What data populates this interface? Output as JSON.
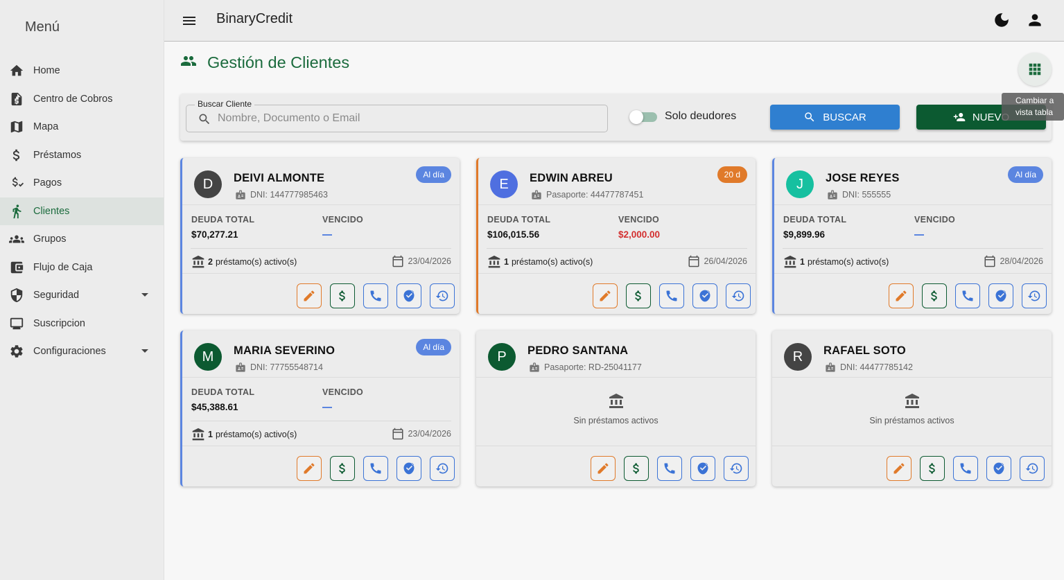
{
  "sidebar": {
    "title": "Menú",
    "items": [
      {
        "label": "Home",
        "icon": "home-icon"
      },
      {
        "label": "Centro de Cobros",
        "icon": "receipt-icon"
      },
      {
        "label": "Mapa",
        "icon": "map-icon"
      },
      {
        "label": "Préstamos",
        "icon": "dollar-icon"
      },
      {
        "label": "Pagos",
        "icon": "payment-icon"
      },
      {
        "label": "Clientes",
        "icon": "person-icon",
        "active": true
      },
      {
        "label": "Grupos",
        "icon": "groups-icon"
      },
      {
        "label": "Flujo de Caja",
        "icon": "wallet-icon"
      },
      {
        "label": "Seguridad",
        "icon": "shield-icon",
        "expandable": true
      },
      {
        "label": "Suscripcion",
        "icon": "monitor-icon"
      },
      {
        "label": "Configuraciones",
        "icon": "gear-icon",
        "expandable": true
      }
    ]
  },
  "topbar": {
    "title": "BinaryCredit"
  },
  "page": {
    "title": "Gestión de Clientes",
    "view_tooltip": "Cambiar a vista tabla"
  },
  "search": {
    "legend": "Buscar Cliente",
    "placeholder": "Nombre, Documento o Email",
    "value": "",
    "toggle_label": "Solo deudores",
    "toggle_on": false,
    "search_button": "BUSCAR",
    "new_button": "NUEVO"
  },
  "labels": {
    "total_debt": "DEUDA TOTAL",
    "overdue": "VENCIDO",
    "active_loans_suffix": "préstamo(s) activo(s)",
    "no_loans": "Sin préstamos activos"
  },
  "colors": {
    "brand_green": "#1b6b3d",
    "accent_blue": "#2f7fd0",
    "warning_orange": "#e07a2a",
    "overdue_red": "#d32f2f"
  },
  "clients": [
    {
      "initial": "D",
      "name": "DEIVI ALMONTE",
      "doc": "DNI: 144777985463",
      "badge": "Al día",
      "total_debt": "$70,277.21",
      "overdue": "—",
      "loans": "2",
      "date": "23/04/2026"
    },
    {
      "initial": "E",
      "name": "EDWIN ABREU",
      "doc": "Pasaporte: 44477787451",
      "badge": "20 d",
      "total_debt": "$106,015.56",
      "overdue": "$2,000.00",
      "loans": "1",
      "date": "26/04/2026"
    },
    {
      "initial": "J",
      "name": "JOSE REYES",
      "doc": "DNI: 555555",
      "badge": "Al día",
      "total_debt": "$9,899.96",
      "overdue": "—",
      "loans": "1",
      "date": "28/04/2026"
    },
    {
      "initial": "M",
      "name": "MARIA SEVERINO",
      "doc": "DNI: 77755548714",
      "badge": "Al día",
      "total_debt": "$45,388.61",
      "overdue": "—",
      "loans": "1",
      "date": "23/04/2026"
    },
    {
      "initial": "P",
      "name": "PEDRO SANTANA",
      "doc": "Pasaporte: RD-25041177"
    },
    {
      "initial": "R",
      "name": "RAFAEL SOTO",
      "doc": "DNI: 44477785142"
    }
  ]
}
